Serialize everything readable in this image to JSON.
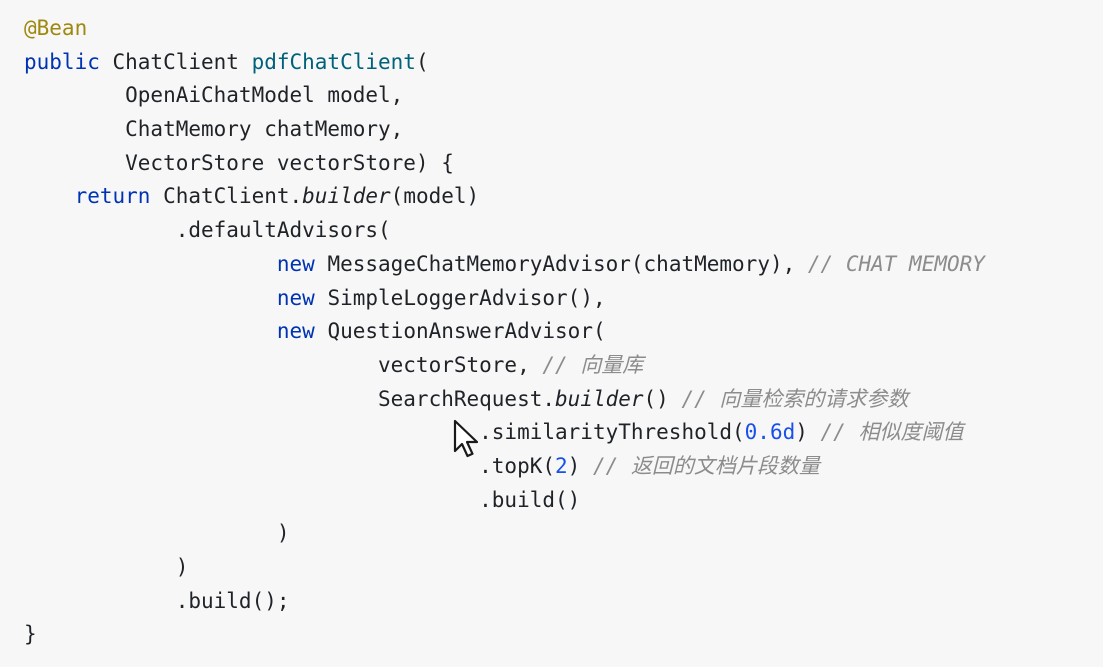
{
  "code": {
    "lines": [
      [
        {
          "t": "@Bean",
          "c": "ann"
        }
      ],
      [
        {
          "t": "public",
          "c": "kw"
        },
        {
          "t": " ChatClient "
        },
        {
          "t": "pdfChatClient",
          "c": "fn"
        },
        {
          "t": "("
        }
      ],
      [
        {
          "t": "        OpenAiChatModel model,"
        }
      ],
      [
        {
          "t": "        ChatMemory chatMemory,"
        }
      ],
      [
        {
          "t": "        VectorStore vectorStore) {"
        }
      ],
      [
        {
          "t": "    "
        },
        {
          "t": "return",
          "c": "kw"
        },
        {
          "t": " ChatClient."
        },
        {
          "t": "builder",
          "c": "it"
        },
        {
          "t": "(model)"
        }
      ],
      [
        {
          "t": "            .defaultAdvisors("
        }
      ],
      [
        {
          "t": "                    "
        },
        {
          "t": "new",
          "c": "kw"
        },
        {
          "t": " MessageChatMemoryAdvisor(chatMemory), "
        },
        {
          "t": "// CHAT MEMORY",
          "c": "cmt"
        }
      ],
      [
        {
          "t": "                    "
        },
        {
          "t": "new",
          "c": "kw"
        },
        {
          "t": " SimpleLoggerAdvisor(),"
        }
      ],
      [
        {
          "t": "                    "
        },
        {
          "t": "new",
          "c": "kw"
        },
        {
          "t": " QuestionAnswerAdvisor("
        }
      ],
      [
        {
          "t": "                            vectorStore, "
        },
        {
          "t": "// ",
          "c": "cmt"
        },
        {
          "t": "向量库",
          "c": "cmt cjk"
        }
      ],
      [
        {
          "t": "                            SearchRequest."
        },
        {
          "t": "builder",
          "c": "it"
        },
        {
          "t": "() "
        },
        {
          "t": "// ",
          "c": "cmt"
        },
        {
          "t": "向量检索的请求参数",
          "c": "cmt cjk"
        }
      ],
      [
        {
          "t": "                                    .similarityThreshold("
        },
        {
          "t": "0.6d",
          "c": "num"
        },
        {
          "t": ") "
        },
        {
          "t": "// ",
          "c": "cmt"
        },
        {
          "t": "相似度阈值",
          "c": "cmt cjk"
        }
      ],
      [
        {
          "t": "                                    .topK("
        },
        {
          "t": "2",
          "c": "num"
        },
        {
          "t": ") "
        },
        {
          "t": "// ",
          "c": "cmt"
        },
        {
          "t": "返回的文档片段数量",
          "c": "cmt cjk"
        }
      ],
      [
        {
          "t": "                                    .build()"
        }
      ],
      [
        {
          "t": "                    )"
        }
      ],
      [
        {
          "t": "            )"
        }
      ],
      [
        {
          "t": "            .build();"
        }
      ],
      [
        {
          "t": "}"
        }
      ]
    ]
  },
  "colors": {
    "background": "#f7f7f7",
    "text": "#1f2328",
    "annotation": "#9e880d",
    "keyword": "#0033b3",
    "method_declaration": "#00627a",
    "number": "#1750eb",
    "comment": "#8c8c8c"
  },
  "cursor": {
    "icon": "mouse-pointer-icon"
  }
}
